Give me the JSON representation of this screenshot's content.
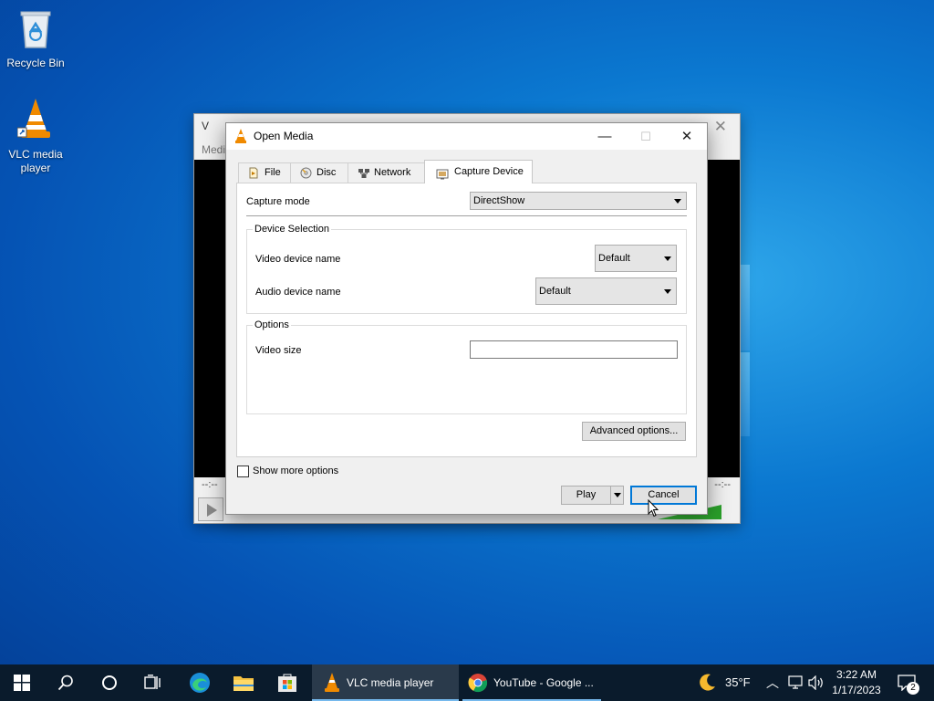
{
  "desktop": {
    "icons": [
      {
        "label": "Recycle Bin",
        "icon": "recycle-bin-icon"
      },
      {
        "label": "VLC media player",
        "icon": "vlc-cone-icon"
      }
    ]
  },
  "vlc_window": {
    "title": "V",
    "menu_partial": "Medi",
    "time_left": "--:--",
    "time_right": "--:--"
  },
  "dialog": {
    "title": "Open Media",
    "tabs": [
      {
        "label": "File",
        "icon": "file-icon"
      },
      {
        "label": "Disc",
        "icon": "disc-icon"
      },
      {
        "label": "Network",
        "icon": "network-icon"
      },
      {
        "label": "Capture Device",
        "icon": "capture-device-icon",
        "active": true
      }
    ],
    "capture_mode": {
      "label": "Capture mode",
      "value": "DirectShow"
    },
    "device_selection": {
      "legend": "Device Selection",
      "video_label": "Video device name",
      "video_value": "Default",
      "audio_label": "Audio device name",
      "audio_value": "Default"
    },
    "options": {
      "legend": "Options",
      "video_size_label": "Video size",
      "video_size_value": ""
    },
    "advanced_button": "Advanced options...",
    "show_more_options": "Show more options",
    "play_button": "Play",
    "cancel_button": "Cancel"
  },
  "taskbar": {
    "apps": [
      {
        "label": "VLC media player",
        "active": true
      },
      {
        "label": "YouTube - Google ...",
        "active": false
      }
    ],
    "weather": "35°F",
    "time": "3:22 AM",
    "date": "1/17/2023",
    "notification_count": "2"
  },
  "colors": {
    "accent": "#0078d7",
    "desktop_blue": "#0b78d0",
    "taskbar": "#0a1b2c",
    "vlc_orange": "#f08a00"
  }
}
